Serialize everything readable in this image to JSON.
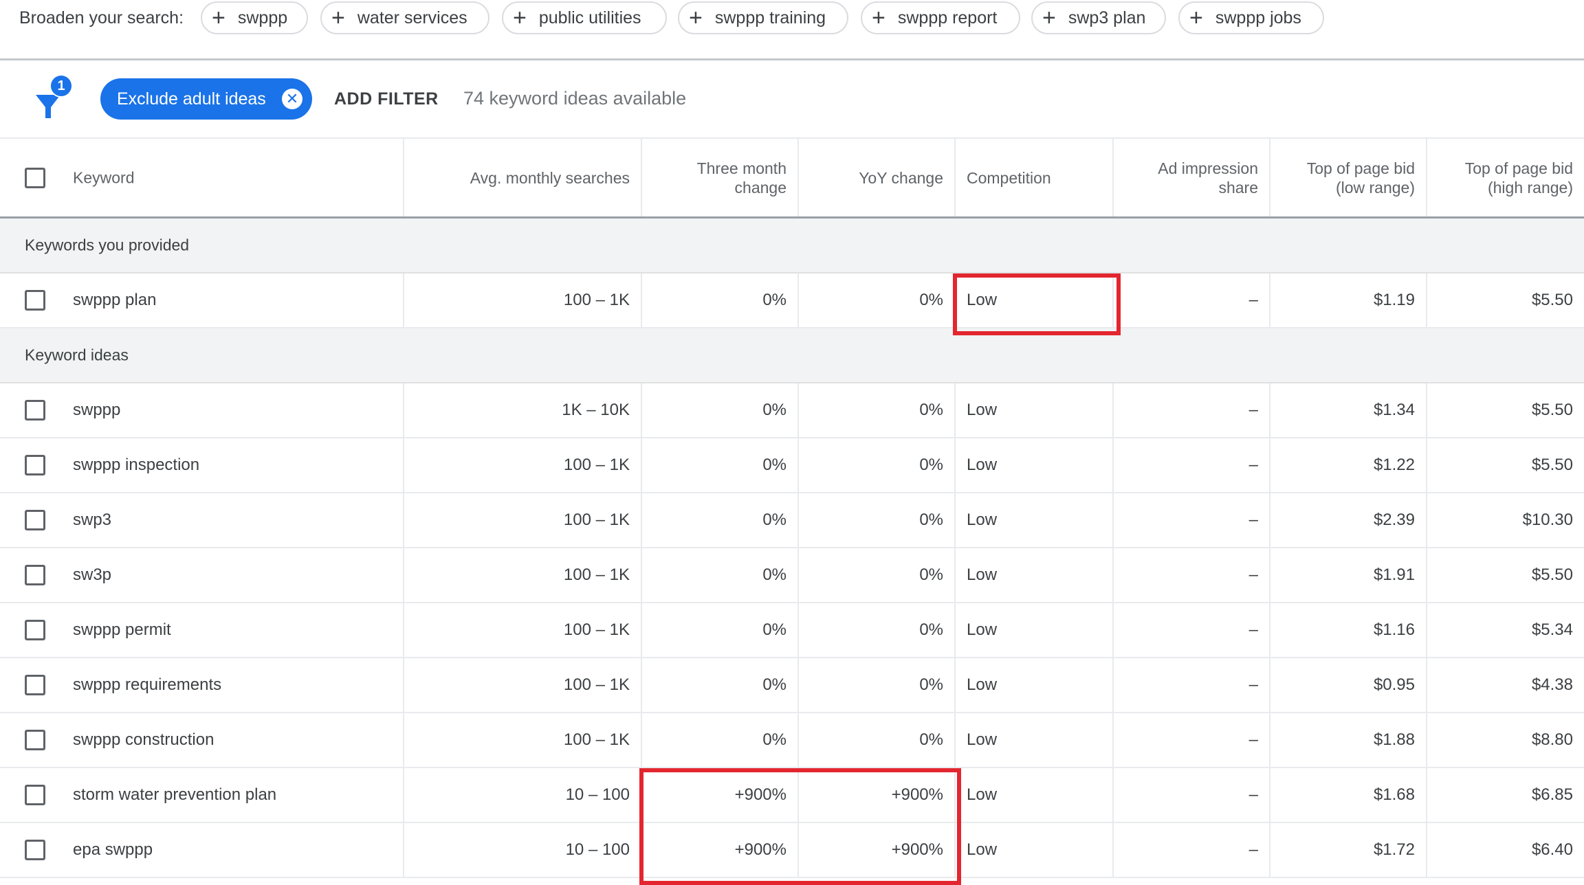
{
  "broaden": {
    "label": "Broaden your search:",
    "chips": [
      {
        "label": "swppp"
      },
      {
        "label": "water services"
      },
      {
        "label": "public utilities"
      },
      {
        "label": "swppp training"
      },
      {
        "label": "swppp report"
      },
      {
        "label": "swp3 plan"
      },
      {
        "label": "swppp jobs"
      }
    ]
  },
  "filters": {
    "badge_count": "1",
    "active_filter": "Exclude adult ideas",
    "add_filter": "ADD FILTER",
    "ideas_available": "74 keyword ideas available"
  },
  "colors": {
    "accent": "#1a73e8",
    "highlight": "#e3262f",
    "section_bg": "#f1f3f4"
  },
  "table": {
    "columns": [
      {
        "label": "Keyword"
      },
      {
        "label": "Avg. monthly searches"
      },
      {
        "label": "Three month change"
      },
      {
        "label": "YoY change"
      },
      {
        "label": "Competition"
      },
      {
        "label": "Ad impression share"
      },
      {
        "label": "Top of page bid (low range)"
      },
      {
        "label": "Top of page bid (high range)"
      }
    ],
    "provided_section": "Keywords you provided",
    "provided": [
      {
        "keyword": "swppp plan",
        "searches": "100 – 1K",
        "three_month": "0%",
        "yoy": "0%",
        "competition": "Low",
        "impression": "–",
        "bid_low": "$1.19",
        "bid_high": "$5.50"
      }
    ],
    "ideas_section": "Keyword ideas",
    "ideas": [
      {
        "keyword": "swppp",
        "searches": "1K – 10K",
        "three_month": "0%",
        "yoy": "0%",
        "competition": "Low",
        "impression": "–",
        "bid_low": "$1.34",
        "bid_high": "$5.50"
      },
      {
        "keyword": "swppp inspection",
        "searches": "100 – 1K",
        "three_month": "0%",
        "yoy": "0%",
        "competition": "Low",
        "impression": "–",
        "bid_low": "$1.22",
        "bid_high": "$5.50"
      },
      {
        "keyword": "swp3",
        "searches": "100 – 1K",
        "three_month": "0%",
        "yoy": "0%",
        "competition": "Low",
        "impression": "–",
        "bid_low": "$2.39",
        "bid_high": "$10.30"
      },
      {
        "keyword": "sw3p",
        "searches": "100 – 1K",
        "three_month": "0%",
        "yoy": "0%",
        "competition": "Low",
        "impression": "–",
        "bid_low": "$1.91",
        "bid_high": "$5.50"
      },
      {
        "keyword": "swppp permit",
        "searches": "100 – 1K",
        "three_month": "0%",
        "yoy": "0%",
        "competition": "Low",
        "impression": "–",
        "bid_low": "$1.16",
        "bid_high": "$5.34"
      },
      {
        "keyword": "swppp requirements",
        "searches": "100 – 1K",
        "three_month": "0%",
        "yoy": "0%",
        "competition": "Low",
        "impression": "–",
        "bid_low": "$0.95",
        "bid_high": "$4.38"
      },
      {
        "keyword": "swppp construction",
        "searches": "100 – 1K",
        "three_month": "0%",
        "yoy": "0%",
        "competition": "Low",
        "impression": "–",
        "bid_low": "$1.88",
        "bid_high": "$8.80"
      },
      {
        "keyword": "storm water prevention plan",
        "searches": "10 – 100",
        "three_month": "+900%",
        "yoy": "+900%",
        "competition": "Low",
        "impression": "–",
        "bid_low": "$1.68",
        "bid_high": "$6.85"
      },
      {
        "keyword": "epa swppp",
        "searches": "10 – 100",
        "three_month": "+900%",
        "yoy": "+900%",
        "competition": "Low",
        "impression": "–",
        "bid_low": "$1.72",
        "bid_high": "$6.40"
      }
    ]
  }
}
